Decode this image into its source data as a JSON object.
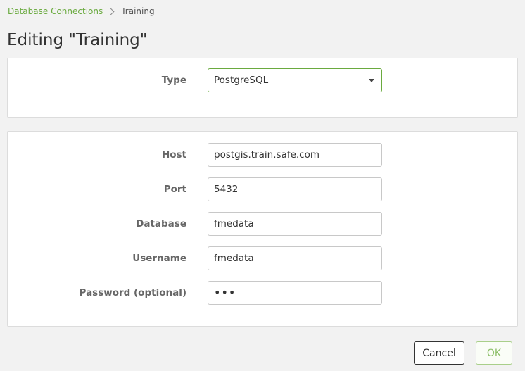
{
  "breadcrumb": {
    "parent": "Database Connections",
    "current": "Training"
  },
  "page_title": "Editing \"Training\"",
  "type_section": {
    "type_label": "Type",
    "type_value": "PostgreSQL"
  },
  "connection": {
    "host_label": "Host",
    "host_value": "postgis.train.safe.com",
    "port_label": "Port",
    "port_value": "5432",
    "database_label": "Database",
    "database_value": "fmedata",
    "username_label": "Username",
    "username_value": "fmedata",
    "password_label": "Password (optional)",
    "password_value": "•••"
  },
  "actions": {
    "cancel_label": "Cancel",
    "ok_label": "OK"
  },
  "colors": {
    "accent": "#6aaa3f",
    "ok_disabled_text": "#8cbf68",
    "background": "#f2f2f2"
  }
}
